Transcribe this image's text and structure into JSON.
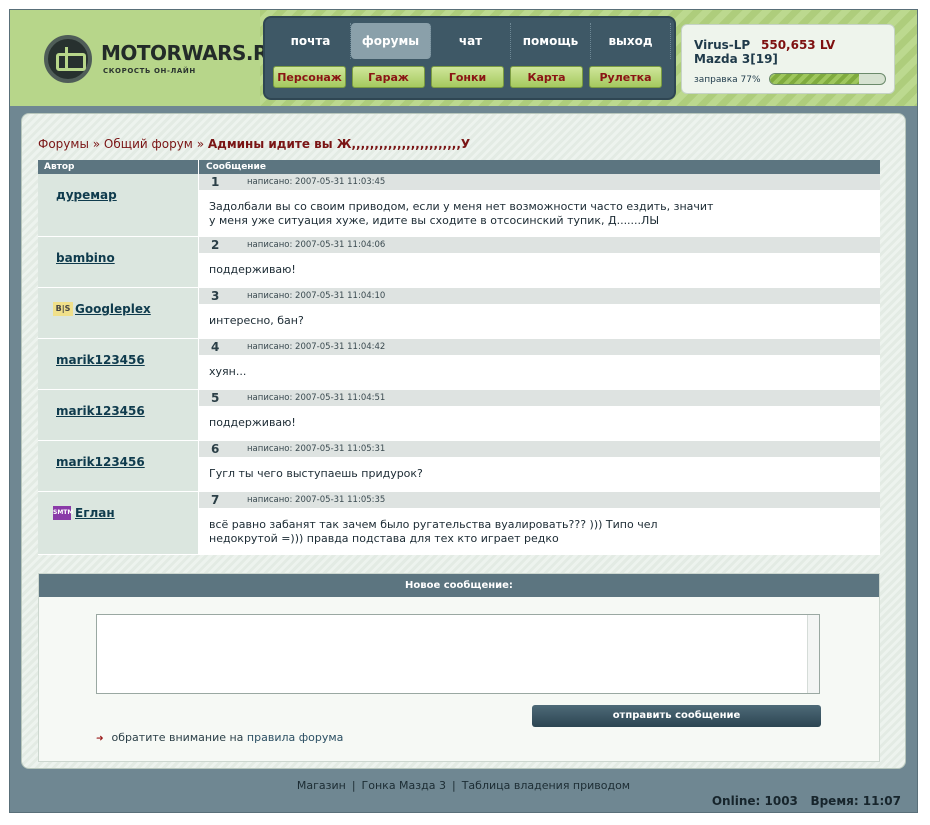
{
  "site": {
    "name": "MOTORWARS.RU",
    "slogan": "СКОРОСТЬ ОН-ЛАЙН"
  },
  "nav": {
    "top": [
      {
        "label": "почта",
        "active": false
      },
      {
        "label": "форумы",
        "active": true
      },
      {
        "label": "чат",
        "active": false
      },
      {
        "label": "помощь",
        "active": false
      },
      {
        "label": "выход",
        "active": false
      }
    ],
    "sub": [
      "Персонаж",
      "Гараж",
      "Гонки",
      "Карта",
      "Рулетка"
    ]
  },
  "user": {
    "name": "Virus-LP",
    "balance": "550,653 LV",
    "car": "Mazda 3[19]",
    "fuel_label": "заправка 77%",
    "fuel_percent": 77
  },
  "breadcrumb": {
    "forums": "Форумы",
    "sep": "»",
    "forum": "Общий форум",
    "topic": "Админы идите вы Ж,,,,,,,,,,,,,,,,,,,,,,,,У"
  },
  "table": {
    "col_author": "Автор",
    "col_message": "Сообщение"
  },
  "posts": [
    {
      "author": "дуремар",
      "badge": "",
      "num": "1",
      "date": "написано: 2007-05-31 11:03:45",
      "text": "Задолбали вы со своим приводом, если у меня нет возможности часто ездить, значит\nу меня уже ситуация хуже, идите вы сходите в отсосинский тупик, Д.......ЛЫ"
    },
    {
      "author": "bambino",
      "badge": "",
      "num": "2",
      "date": "написано: 2007-05-31 11:04:06",
      "text": "поддерживаю!"
    },
    {
      "author": "Googleplex",
      "badge": "B|S",
      "num": "3",
      "date": "написано: 2007-05-31 11:04:10",
      "text": "интересно, бан?"
    },
    {
      "author": "marik123456",
      "badge": "",
      "num": "4",
      "date": "написано: 2007-05-31 11:04:42",
      "text": "хуян..."
    },
    {
      "author": "marik123456",
      "badge": "",
      "num": "5",
      "date": "написано: 2007-05-31 11:04:51",
      "text": "поддерживаю!"
    },
    {
      "author": "marik123456",
      "badge": "",
      "num": "6",
      "date": "написано: 2007-05-31 11:05:31",
      "text": "Гугл ты чего выступаешь придурок?"
    },
    {
      "author": "Еглан",
      "badge": "SMTM",
      "num": "7",
      "date": "написано: 2007-05-31 11:05:35",
      "text": "всё равно забанят так зачем было ругательства вуалировать??? ))) Типо чел\nнедокрутой =))) правда подстава для тех кто играет редко"
    }
  ],
  "reply": {
    "title": "Новое сообщение:",
    "send_label": "отправить сообщение",
    "note_prefix": "обратите внимание на",
    "note_link": "правила форума"
  },
  "footer": {
    "links": [
      "Магазин",
      "Гонка Мазда 3",
      "Таблица владения приводом"
    ],
    "online": "Online: 1003",
    "time": "Время: 11:07"
  }
}
